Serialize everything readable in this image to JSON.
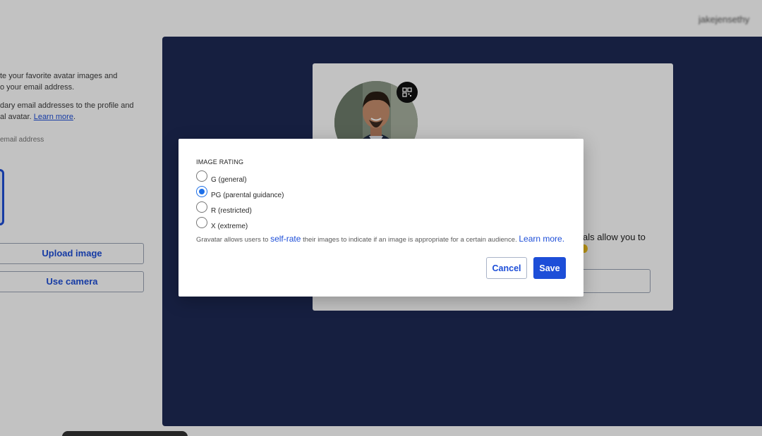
{
  "header": {
    "user_email": "jakejensethy"
  },
  "left": {
    "text_line1": "te your favorite avatar images and",
    "text_line2": "o your email address.",
    "text_line3": "dary email addresses to the profile and",
    "text_line4_prefix": "al avatar. ",
    "learn_more": "Learn more",
    "text_line4_suffix": ".",
    "email_hint": "email address",
    "upload_label": "Upload image",
    "camera_label": "Use camera"
  },
  "card": {
    "text_fragment": "als allow you to"
  },
  "modal": {
    "heading": "IMAGE RATING",
    "options": [
      {
        "label": "G (general)",
        "checked": false
      },
      {
        "label": "PG (parental guidance)",
        "checked": true
      },
      {
        "label": "R (restricted)",
        "checked": false
      },
      {
        "label": "X (extreme)",
        "checked": false
      }
    ],
    "note_prefix": "Gravatar allows users to ",
    "note_link1": "self-rate",
    "note_middle": " their images to indicate if an image is appropriate for a certain audience. ",
    "note_link2": "Learn more.",
    "cancel_label": "Cancel",
    "save_label": "Save"
  },
  "colors": {
    "accent": "#1d4ed8",
    "panel": "#1e2a55",
    "radio_checked": "#1d6fe8"
  }
}
